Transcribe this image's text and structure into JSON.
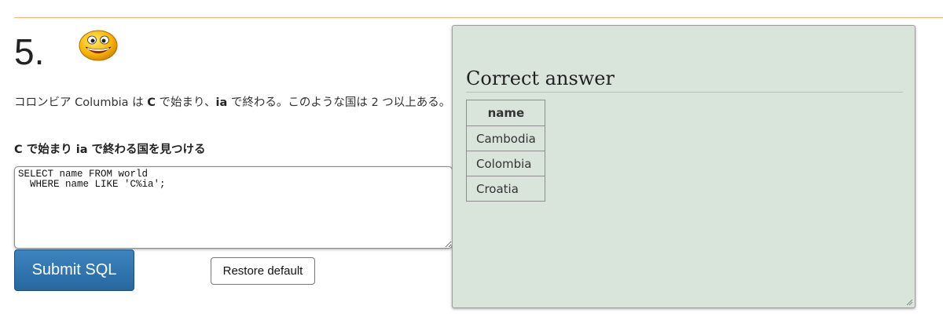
{
  "question": {
    "number": "5.",
    "text_parts": {
      "p1": "コロンビア Columbia は ",
      "b1": "C",
      "p2": " で始まり、",
      "b2": "ia",
      "p3": " で終わる。このような国は 2 つ以上ある。"
    },
    "task_heading": "C で始まり ia で終わる国を見つける",
    "smiley_icon": "smiley-face-icon"
  },
  "editor": {
    "sql": "SELECT name FROM world\n  WHERE name LIKE 'C%ia';"
  },
  "buttons": {
    "submit_label": "Submit SQL",
    "restore_label": "Restore default"
  },
  "answer": {
    "heading": "Correct answer",
    "columns": [
      "name"
    ],
    "rows": [
      "Cambodia",
      "Colombia",
      "Croatia"
    ]
  },
  "colors": {
    "accent_rule": "#f6b27c",
    "submit_bg": "#2f74b0",
    "answer_bg": "#d9e5da"
  }
}
